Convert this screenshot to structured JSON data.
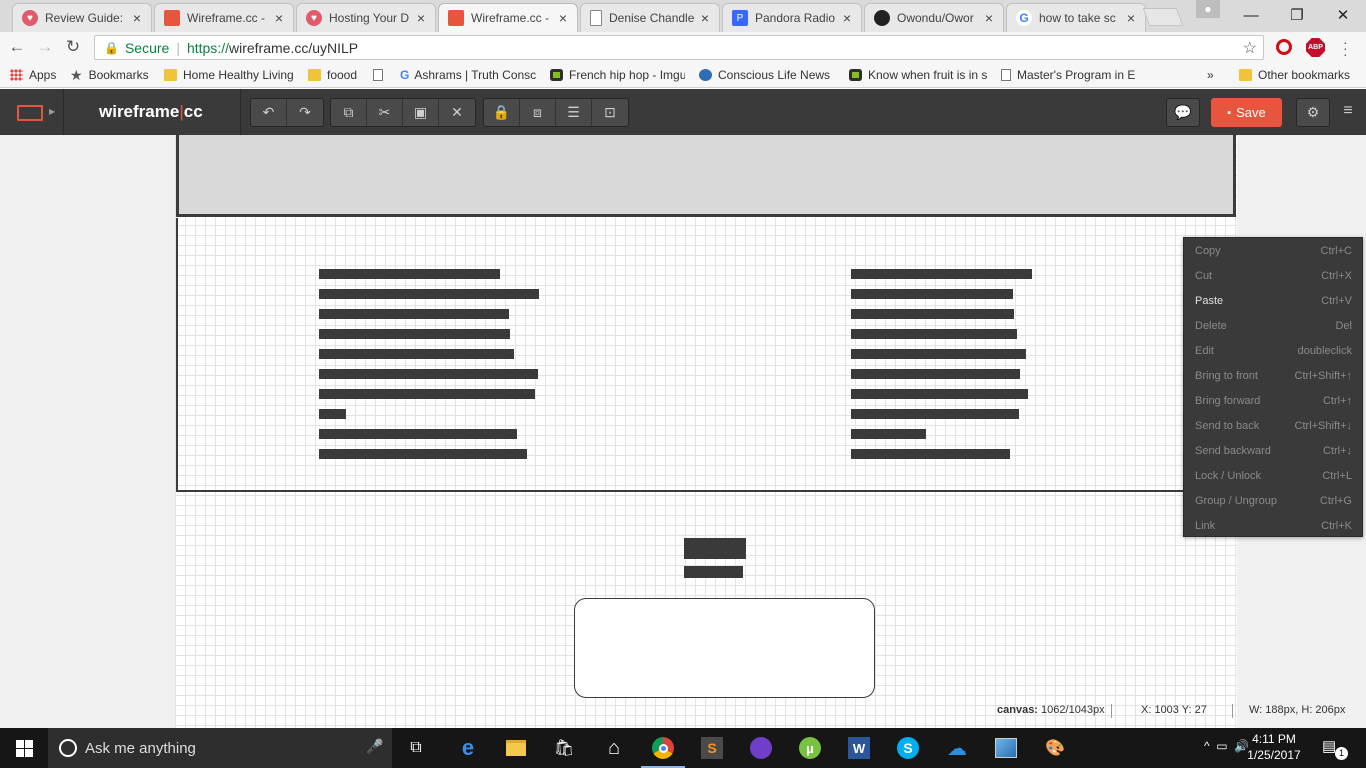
{
  "browser": {
    "tabs": [
      {
        "title": "Review Guide: I",
        "icon": "review-icon",
        "color": "#e05c6a"
      },
      {
        "title": "Wireframe.cc -",
        "icon": "wireframe-icon",
        "color": "#e8553e"
      },
      {
        "title": "Hosting Your D",
        "icon": "review-icon",
        "color": "#e05c6a"
      },
      {
        "title": "Wireframe.cc -",
        "icon": "wireframe-icon",
        "color": "#e8553e"
      },
      {
        "title": "Denise Chandle",
        "icon": "document-icon",
        "color": "#777777"
      },
      {
        "title": "Pandora Radio",
        "icon": "pandora-icon",
        "color": "#3668ff"
      },
      {
        "title": "Owondu/Owor",
        "icon": "github-icon",
        "color": "#222222"
      },
      {
        "title": "how to take sc",
        "icon": "google-icon",
        "color": "#4285f4"
      }
    ],
    "active_tab": 3,
    "secure_label": "Secure",
    "url_scheme": "https://",
    "url_rest": "wireframe.cc/uyNILP",
    "bookmarks": [
      {
        "label": "Apps",
        "icon": "apps-grid-icon"
      },
      {
        "label": "Bookmarks",
        "icon": "star-icon"
      },
      {
        "label": "Home Healthy Living",
        "icon": "folder-icon"
      },
      {
        "label": "foood",
        "icon": "folder-icon"
      },
      {
        "label": "",
        "icon": "document-icon"
      },
      {
        "label": "Ashrams | Truth Consc",
        "icon": "google-icon"
      },
      {
        "label": "French hip hop - Imgu",
        "icon": "imgur-icon"
      },
      {
        "label": "Conscious Life News |",
        "icon": "globe-icon"
      },
      {
        "label": "Know when fruit is in s",
        "icon": "imgur-icon"
      },
      {
        "label": "Master's Program in E",
        "icon": "document-icon"
      }
    ],
    "bookmarks_more": "»",
    "other_bookmarks": "Other bookmarks"
  },
  "app": {
    "brand": "wireframe",
    "brand_sep": "|",
    "brand_suffix": "cc",
    "save_label": "Save",
    "colors": {
      "accent": "#e8553e",
      "toolbar": "#3a3a3a"
    }
  },
  "statusbar": {
    "canvas_label": "canvas:",
    "canvas_value": "1062/1043px",
    "coords": "X: 1003 Y: 27",
    "size": "W: 188px, H: 206px"
  },
  "context_menu": [
    {
      "label": "Copy",
      "shortcut": "Ctrl+C",
      "enabled": false
    },
    {
      "label": "Cut",
      "shortcut": "Ctrl+X",
      "enabled": false
    },
    {
      "label": "Paste",
      "shortcut": "Ctrl+V",
      "enabled": true
    },
    {
      "label": "Delete",
      "shortcut": "Del",
      "enabled": false
    },
    {
      "label": "Edit",
      "shortcut": "doubleclick",
      "enabled": false
    },
    {
      "label": "Bring to front",
      "shortcut": "Ctrl+Shift+↑",
      "enabled": false
    },
    {
      "label": "Bring forward",
      "shortcut": "Ctrl+↑",
      "enabled": false
    },
    {
      "label": "Send to back",
      "shortcut": "Ctrl+Shift+↓",
      "enabled": false
    },
    {
      "label": "Send backward",
      "shortcut": "Ctrl+↓",
      "enabled": false
    },
    {
      "label": "Lock / Unlock",
      "shortcut": "Ctrl+L",
      "enabled": false
    },
    {
      "label": "Group / Ungroup",
      "shortcut": "Ctrl+G",
      "enabled": false
    },
    {
      "label": "Link",
      "shortcut": "Ctrl+K",
      "enabled": false
    }
  ],
  "taskbar": {
    "search_placeholder": "Ask me anything",
    "time": "4:11 PM",
    "date": "1/25/2017",
    "notification_count": "1"
  }
}
